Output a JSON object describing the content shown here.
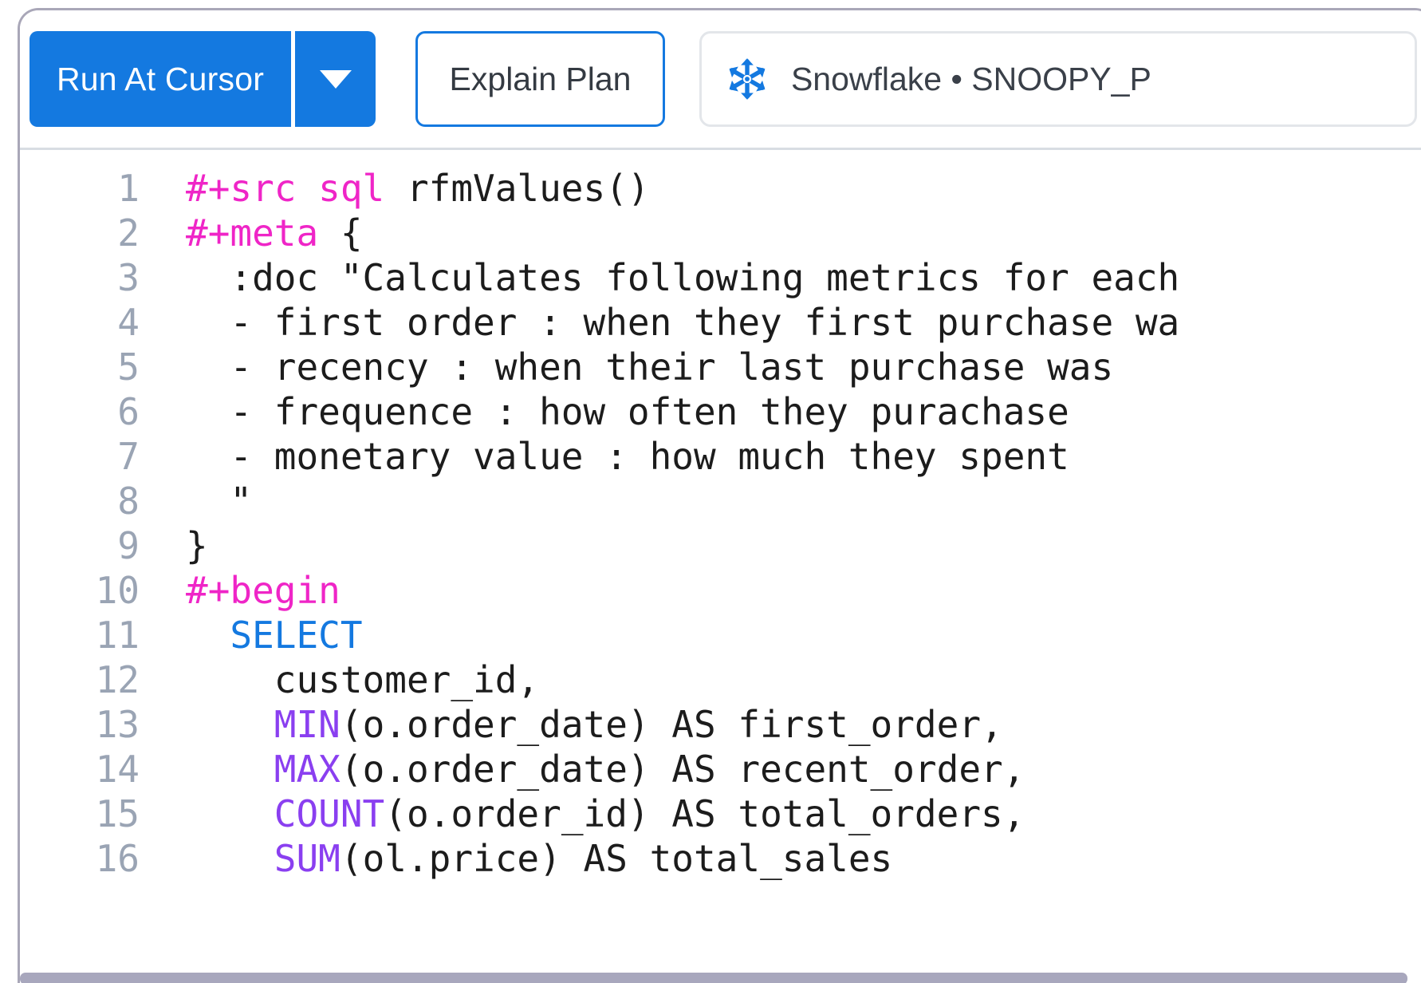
{
  "window": {
    "accent_color": "#1479e0",
    "border_color": "#a9a7b8"
  },
  "toolbar": {
    "run_at_cursor_label": "Run At Cursor",
    "run_options_icon": "chevron-down-icon",
    "explain_plan_label": "Explain Plan",
    "connection": {
      "icon": "snowflake-icon",
      "label": "Snowflake • SNOOPY_P",
      "icon_color": "#1479e0"
    }
  },
  "editor": {
    "language": "sql",
    "syntax_colors": {
      "directive": "#ef25c7",
      "keyword": "#1479e0",
      "function": "#8a3ff0",
      "plain": "#1c1c1c",
      "line_number": "#9aa4b4"
    },
    "lines": [
      {
        "number": "1",
        "tokens": [
          {
            "text": "#+src sql",
            "type": "directive"
          },
          {
            "text": " rfmValues()",
            "type": "plain"
          }
        ]
      },
      {
        "number": "2",
        "tokens": [
          {
            "text": "#+meta",
            "type": "directive"
          },
          {
            "text": " {",
            "type": "plain"
          }
        ]
      },
      {
        "number": "3",
        "tokens": [
          {
            "text": "  :doc \"Calculates following metrics for each",
            "type": "plain"
          }
        ]
      },
      {
        "number": "4",
        "tokens": [
          {
            "text": "  - first order : when they first purchase wa",
            "type": "plain"
          }
        ]
      },
      {
        "number": "5",
        "tokens": [
          {
            "text": "  - recency : when their last purchase was",
            "type": "plain"
          }
        ]
      },
      {
        "number": "6",
        "tokens": [
          {
            "text": "  - frequence : how often they purachase",
            "type": "plain"
          }
        ]
      },
      {
        "number": "7",
        "tokens": [
          {
            "text": "  - monetary value : how much they spent",
            "type": "plain"
          }
        ]
      },
      {
        "number": "8",
        "tokens": [
          {
            "text": "  \"",
            "type": "plain"
          }
        ]
      },
      {
        "number": "9",
        "tokens": [
          {
            "text": "}",
            "type": "plain"
          }
        ]
      },
      {
        "number": "10",
        "tokens": [
          {
            "text": "#+begin",
            "type": "directive"
          }
        ]
      },
      {
        "number": "11",
        "tokens": [
          {
            "text": "  ",
            "type": "plain"
          },
          {
            "text": "SELECT",
            "type": "keyword"
          }
        ]
      },
      {
        "number": "12",
        "tokens": [
          {
            "text": "    customer_id,",
            "type": "plain"
          }
        ]
      },
      {
        "number": "13",
        "tokens": [
          {
            "text": "    ",
            "type": "plain"
          },
          {
            "text": "MIN",
            "type": "function"
          },
          {
            "text": "(o.order_date) AS first_order,",
            "type": "plain"
          }
        ]
      },
      {
        "number": "14",
        "tokens": [
          {
            "text": "    ",
            "type": "plain"
          },
          {
            "text": "MAX",
            "type": "function"
          },
          {
            "text": "(o.order_date) AS recent_order,",
            "type": "plain"
          }
        ]
      },
      {
        "number": "15",
        "tokens": [
          {
            "text": "    ",
            "type": "plain"
          },
          {
            "text": "COUNT",
            "type": "function"
          },
          {
            "text": "(o.order_id) AS total_orders,",
            "type": "plain"
          }
        ]
      },
      {
        "number": "16",
        "tokens": [
          {
            "text": "    ",
            "type": "plain"
          },
          {
            "text": "SUM",
            "type": "function"
          },
          {
            "text": "(ol.price) AS total_sales",
            "type": "plain"
          }
        ]
      }
    ]
  }
}
